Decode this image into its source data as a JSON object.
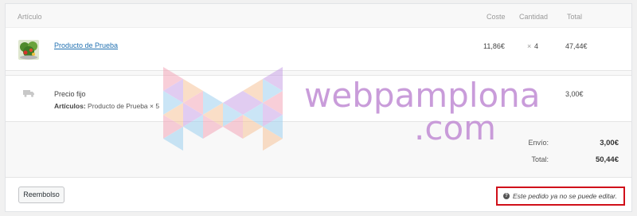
{
  "table": {
    "headers": {
      "item": "Artículo",
      "cost": "Coste",
      "qty": "Cantidad",
      "total": "Total"
    }
  },
  "line_item": {
    "name": "Producto de Prueba",
    "cost": "11,86€",
    "qty_symbol": "×",
    "qty": "4",
    "total": "47,44€",
    "thumbnail_icon": "product-thumbnail"
  },
  "shipping": {
    "icon": "truck-icon",
    "method": "Precio fijo",
    "items_label": "Artículos:",
    "items_value": "Producto de Prueba × 5",
    "total": "3,00€"
  },
  "totals": {
    "shipping_label": "Envío:",
    "shipping_value": "3,00€",
    "total_label": "Total:",
    "total_value": "50,44€"
  },
  "actions": {
    "refund_label": "Reembolso"
  },
  "notice": {
    "icon": "question-circle-icon",
    "text": "Este pedido ya no se puede editar."
  },
  "watermark": {
    "line1": "webpamplona",
    "line2": ".com"
  },
  "colors": {
    "link": "#2271b1",
    "notice_border": "#d0101a",
    "watermark_text": "#c492d6"
  }
}
